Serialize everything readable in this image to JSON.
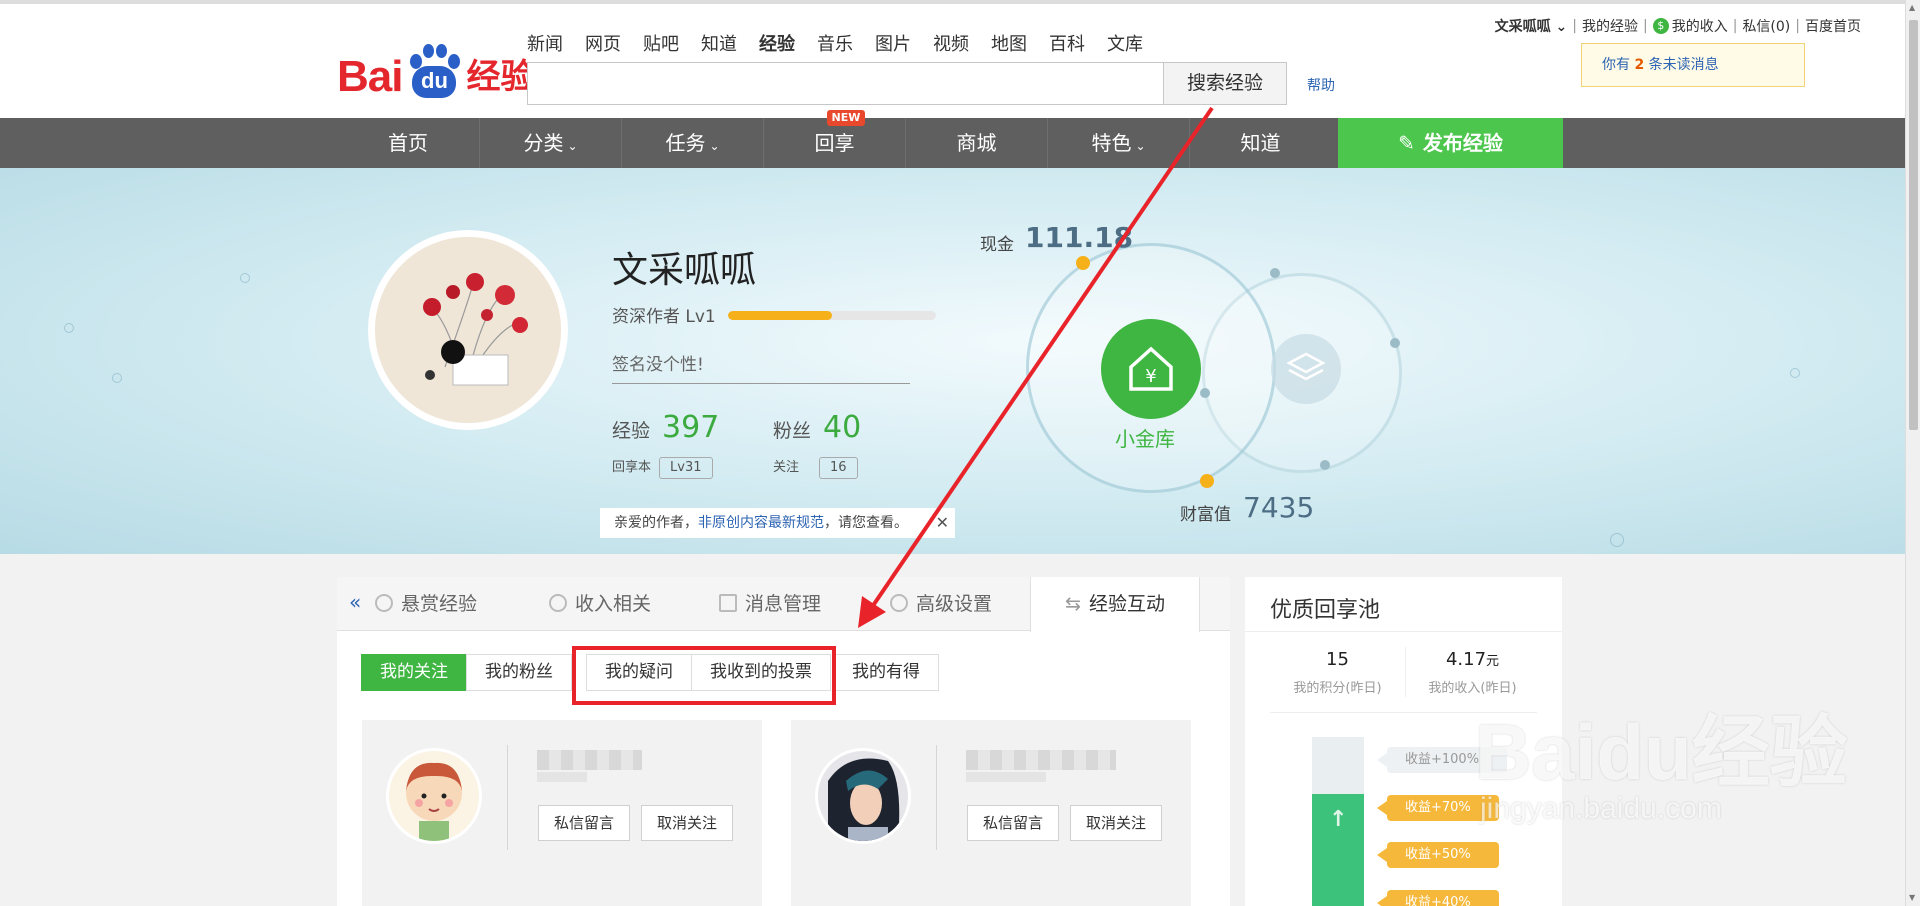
{
  "header": {
    "nav": [
      "新闻",
      "网页",
      "贴吧",
      "知道",
      "经验",
      "音乐",
      "图片",
      "视频",
      "地图",
      "百科",
      "文库"
    ],
    "active_nav": "经验",
    "logo": {
      "bai": "Bai",
      "du": "du",
      "jy": "经验"
    },
    "search_button": "搜索经验",
    "help": "帮助",
    "search_value": ""
  },
  "userbar": {
    "username": "文采呱呱",
    "my_exp": "我的经验",
    "my_income": "我的收入",
    "messages": "私信(0)",
    "baidu_home": "百度首页"
  },
  "notice": {
    "prefix": "你有 ",
    "count": "2",
    "suffix": " 条未读消息"
  },
  "mainnav": {
    "items": [
      "首页",
      "分类",
      "任务",
      "回享",
      "商城",
      "特色",
      "知道"
    ],
    "new_badge": "NEW",
    "publish": "发布经验"
  },
  "profile": {
    "name": "文采呱呱",
    "rank": "资深作者 Lv1",
    "rank_progress": 0.5,
    "motto": "签名没个性!",
    "exp_label": "经验",
    "exp_value": "397",
    "fans_label": "粉丝",
    "fans_value": "40",
    "huixiang_label": "回享本",
    "huixiang_level": "Lv31",
    "follow_label": "关注",
    "follow_value": "16",
    "tip_prefix": "亲爱的作者，",
    "tip_link": "非原创内容最新规范",
    "tip_suffix": "，请您查看。",
    "cash_label": "现金",
    "cash_value": "111.18",
    "bank_label": "小金库",
    "wealth_label": "财富值",
    "wealth_value": "7435"
  },
  "tabs": {
    "items": [
      "悬赏经验",
      "收入相关",
      "消息管理",
      "高级设置",
      "经验互动"
    ],
    "active": "经验互动",
    "subtabs": [
      "我的关注",
      "我的粉丝",
      "我的疑问",
      "我收到的投票",
      "我的有得"
    ],
    "active_subtab": "我的关注"
  },
  "cards": [
    {
      "msg_button": "私信留言",
      "unfollow_button": "取消关注"
    },
    {
      "msg_button": "私信留言",
      "unfollow_button": "取消关注"
    }
  ],
  "side": {
    "title": "优质回享池",
    "points_value": "15",
    "points_label": "我的积分(昨日)",
    "income_value": "4.17",
    "income_unit": "元",
    "income_label": "我的收入(昨日)",
    "tags": [
      "收益+100%",
      "收益+70%",
      "收益+50%",
      "收益+40%"
    ]
  },
  "watermark": {
    "main": "Baidu经验",
    "url": "jingyan.baidu.com"
  },
  "colors": {
    "accent_green": "#3fb542",
    "baidu_red": "#e4262d",
    "baidu_blue": "#2a5fc8",
    "annotation_red": "#e8242a"
  }
}
